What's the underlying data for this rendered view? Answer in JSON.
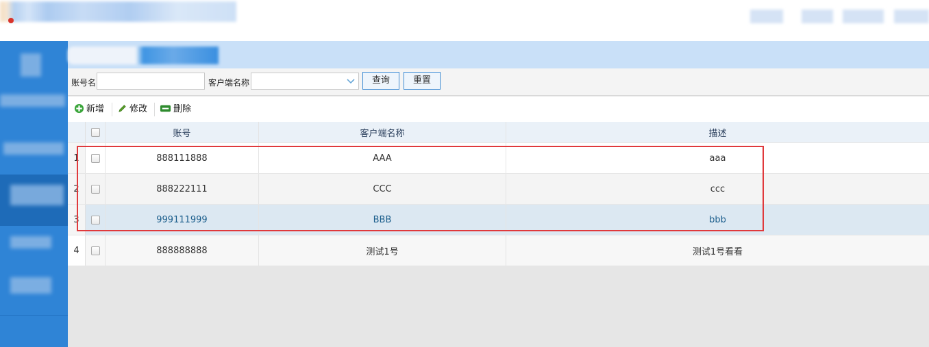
{
  "search": {
    "account_label": "账号名",
    "account_value": "",
    "client_label": "客户端名称",
    "client_value": "",
    "query_button": "查询",
    "reset_button": "重置"
  },
  "toolbar": {
    "add_label": "新增",
    "edit_label": "修改",
    "delete_label": "删除"
  },
  "table": {
    "headers": [
      "账号",
      "客户端名称",
      "描述"
    ],
    "rows": [
      {
        "num": "1",
        "account": "888111888",
        "client": "AAA",
        "desc": "aaa"
      },
      {
        "num": "2",
        "account": "888222111",
        "client": "CCC",
        "desc": "ccc"
      },
      {
        "num": "3",
        "account": "999111999",
        "client": "BBB",
        "desc": "bbb"
      },
      {
        "num": "4",
        "account": "888888888",
        "client": "测试1号",
        "desc": "测试1号看看"
      }
    ],
    "selected_row": 3
  },
  "colors": {
    "sidebar": "#2f84d6",
    "highlight_box": "#e0393c",
    "add_icon": "#3aa53a",
    "delete_icon": "#2e8b2e"
  },
  "icons": {
    "add": "plus-circle-icon",
    "edit": "pencil-icon",
    "delete": "minus-box-icon"
  }
}
